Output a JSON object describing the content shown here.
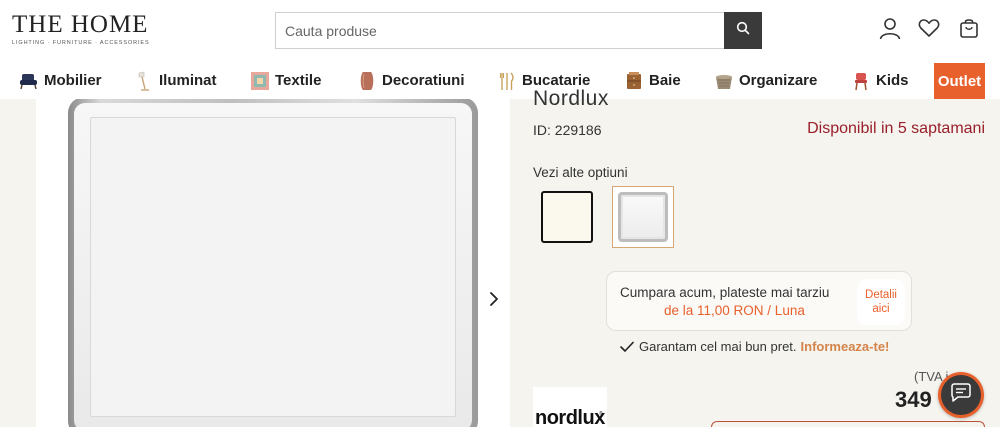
{
  "header": {
    "logo_title": "THE HOME",
    "logo_tagline": "LIGHTING · FURNITURE · ACCESSORIES",
    "search_placeholder": "Cauta produse",
    "search_value": ""
  },
  "nav": {
    "items": [
      {
        "label": "Mobilier",
        "icon": "armchair-icon"
      },
      {
        "label": "Iluminat",
        "icon": "floor-lamp-icon"
      },
      {
        "label": "Textile",
        "icon": "textile-rug-icon"
      },
      {
        "label": "Decoratiuni",
        "icon": "vase-icon"
      },
      {
        "label": "Bucatarie",
        "icon": "cutlery-icon"
      },
      {
        "label": "Baie",
        "icon": "bathroom-cabinet-icon"
      },
      {
        "label": "Organizare",
        "icon": "basket-icon"
      },
      {
        "label": "Kids",
        "icon": "kids-chair-icon"
      }
    ],
    "outlet_label": "Outlet"
  },
  "product": {
    "brand_title": "Nordlux",
    "id_text": "ID: 229186",
    "availability": "Disponibil in 5 saptamani",
    "options_label": "Vezi alte optiuni",
    "bnpl_line1": "Cumpara acum, plateste mai tarziu",
    "bnpl_line2": "de la 11,00 RON / Luna",
    "bnpl_details_1": "Detalii",
    "bnpl_details_2": "aici",
    "guarantee_text": "Garantam cel mai bun pret.",
    "guarantee_link": "Informeaza-te!",
    "brand_logo_text": "nordlux",
    "brand_logo_mark": "®",
    "vat_text": "(TVA i",
    "price": "349"
  },
  "colors": {
    "accent": "#e8602c",
    "availability": "#9a1f2b",
    "link": "#d4834a",
    "content_bg": "#f5f4ef"
  }
}
